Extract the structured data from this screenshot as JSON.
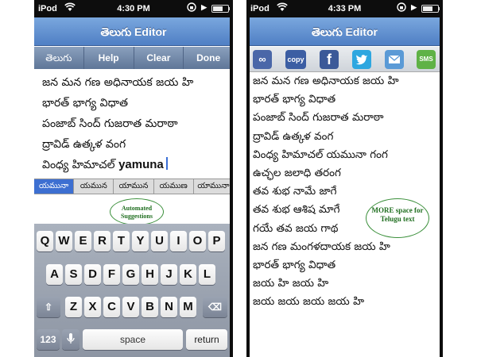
{
  "left": {
    "status": {
      "carrier": "iPod",
      "time": "4:30 PM"
    },
    "title": "తెలుగు Editor",
    "toolbar": [
      "తెలుగు",
      "Help",
      "Clear",
      "Done"
    ],
    "lines": [
      "జన మన గణ అధినాయక జయ హి",
      "భారత్ భాగ్య విధాత",
      "పంజాబ్ సింద్ గుజరాత మరాఠా",
      "ద్రావిడ్ ఉత్కళ వంగ"
    ],
    "current_line_telugu": "వింధ్య హిమాచల్",
    "current_line_latin": "yamuna",
    "suggestions": [
      "యమునా",
      "యమున",
      "యామున",
      "యముణ",
      "యామునా"
    ],
    "callout": "Automated Suggestions",
    "keyboard": {
      "row1": [
        "Q",
        "W",
        "E",
        "R",
        "T",
        "Y",
        "U",
        "I",
        "O",
        "P"
      ],
      "row2": [
        "A",
        "S",
        "D",
        "F",
        "G",
        "H",
        "J",
        "K",
        "L"
      ],
      "row3": [
        "Z",
        "X",
        "C",
        "V",
        "B",
        "N",
        "M"
      ],
      "numbers": "123",
      "space": "space",
      "return": "return"
    }
  },
  "right": {
    "status": {
      "carrier": "iPod",
      "time": "4:33 PM"
    },
    "title": "తెలుగు Editor",
    "share_icons": {
      "copy": "copy",
      "sms": "SMS"
    },
    "lines": [
      "జన మన గణ అధినాయక జయ హి",
      "భారత్ భాగ్య విధాత",
      "పంజాబ్ సింద్ గుజరాత మరాఠా",
      "ద్రావిడ్ ఉత్కళ వంగ",
      "వింధ్య హిమాచల్ యమునా గంగ",
      "ఉచ్ఛల జలాధి తరంగ",
      "తవ శుభ నామే జాగే",
      "తవ శుభ ఆశిష మాగే",
      "గయే తవ జయ గాథ",
      "జన గణ మంగళదాయక జయ హి",
      "భారత్ భాగ్య విధాత",
      "జయ హి జయ హి",
      "జయ జయ జయ జయ హి"
    ],
    "callout": "MORE space for Telugu text"
  }
}
